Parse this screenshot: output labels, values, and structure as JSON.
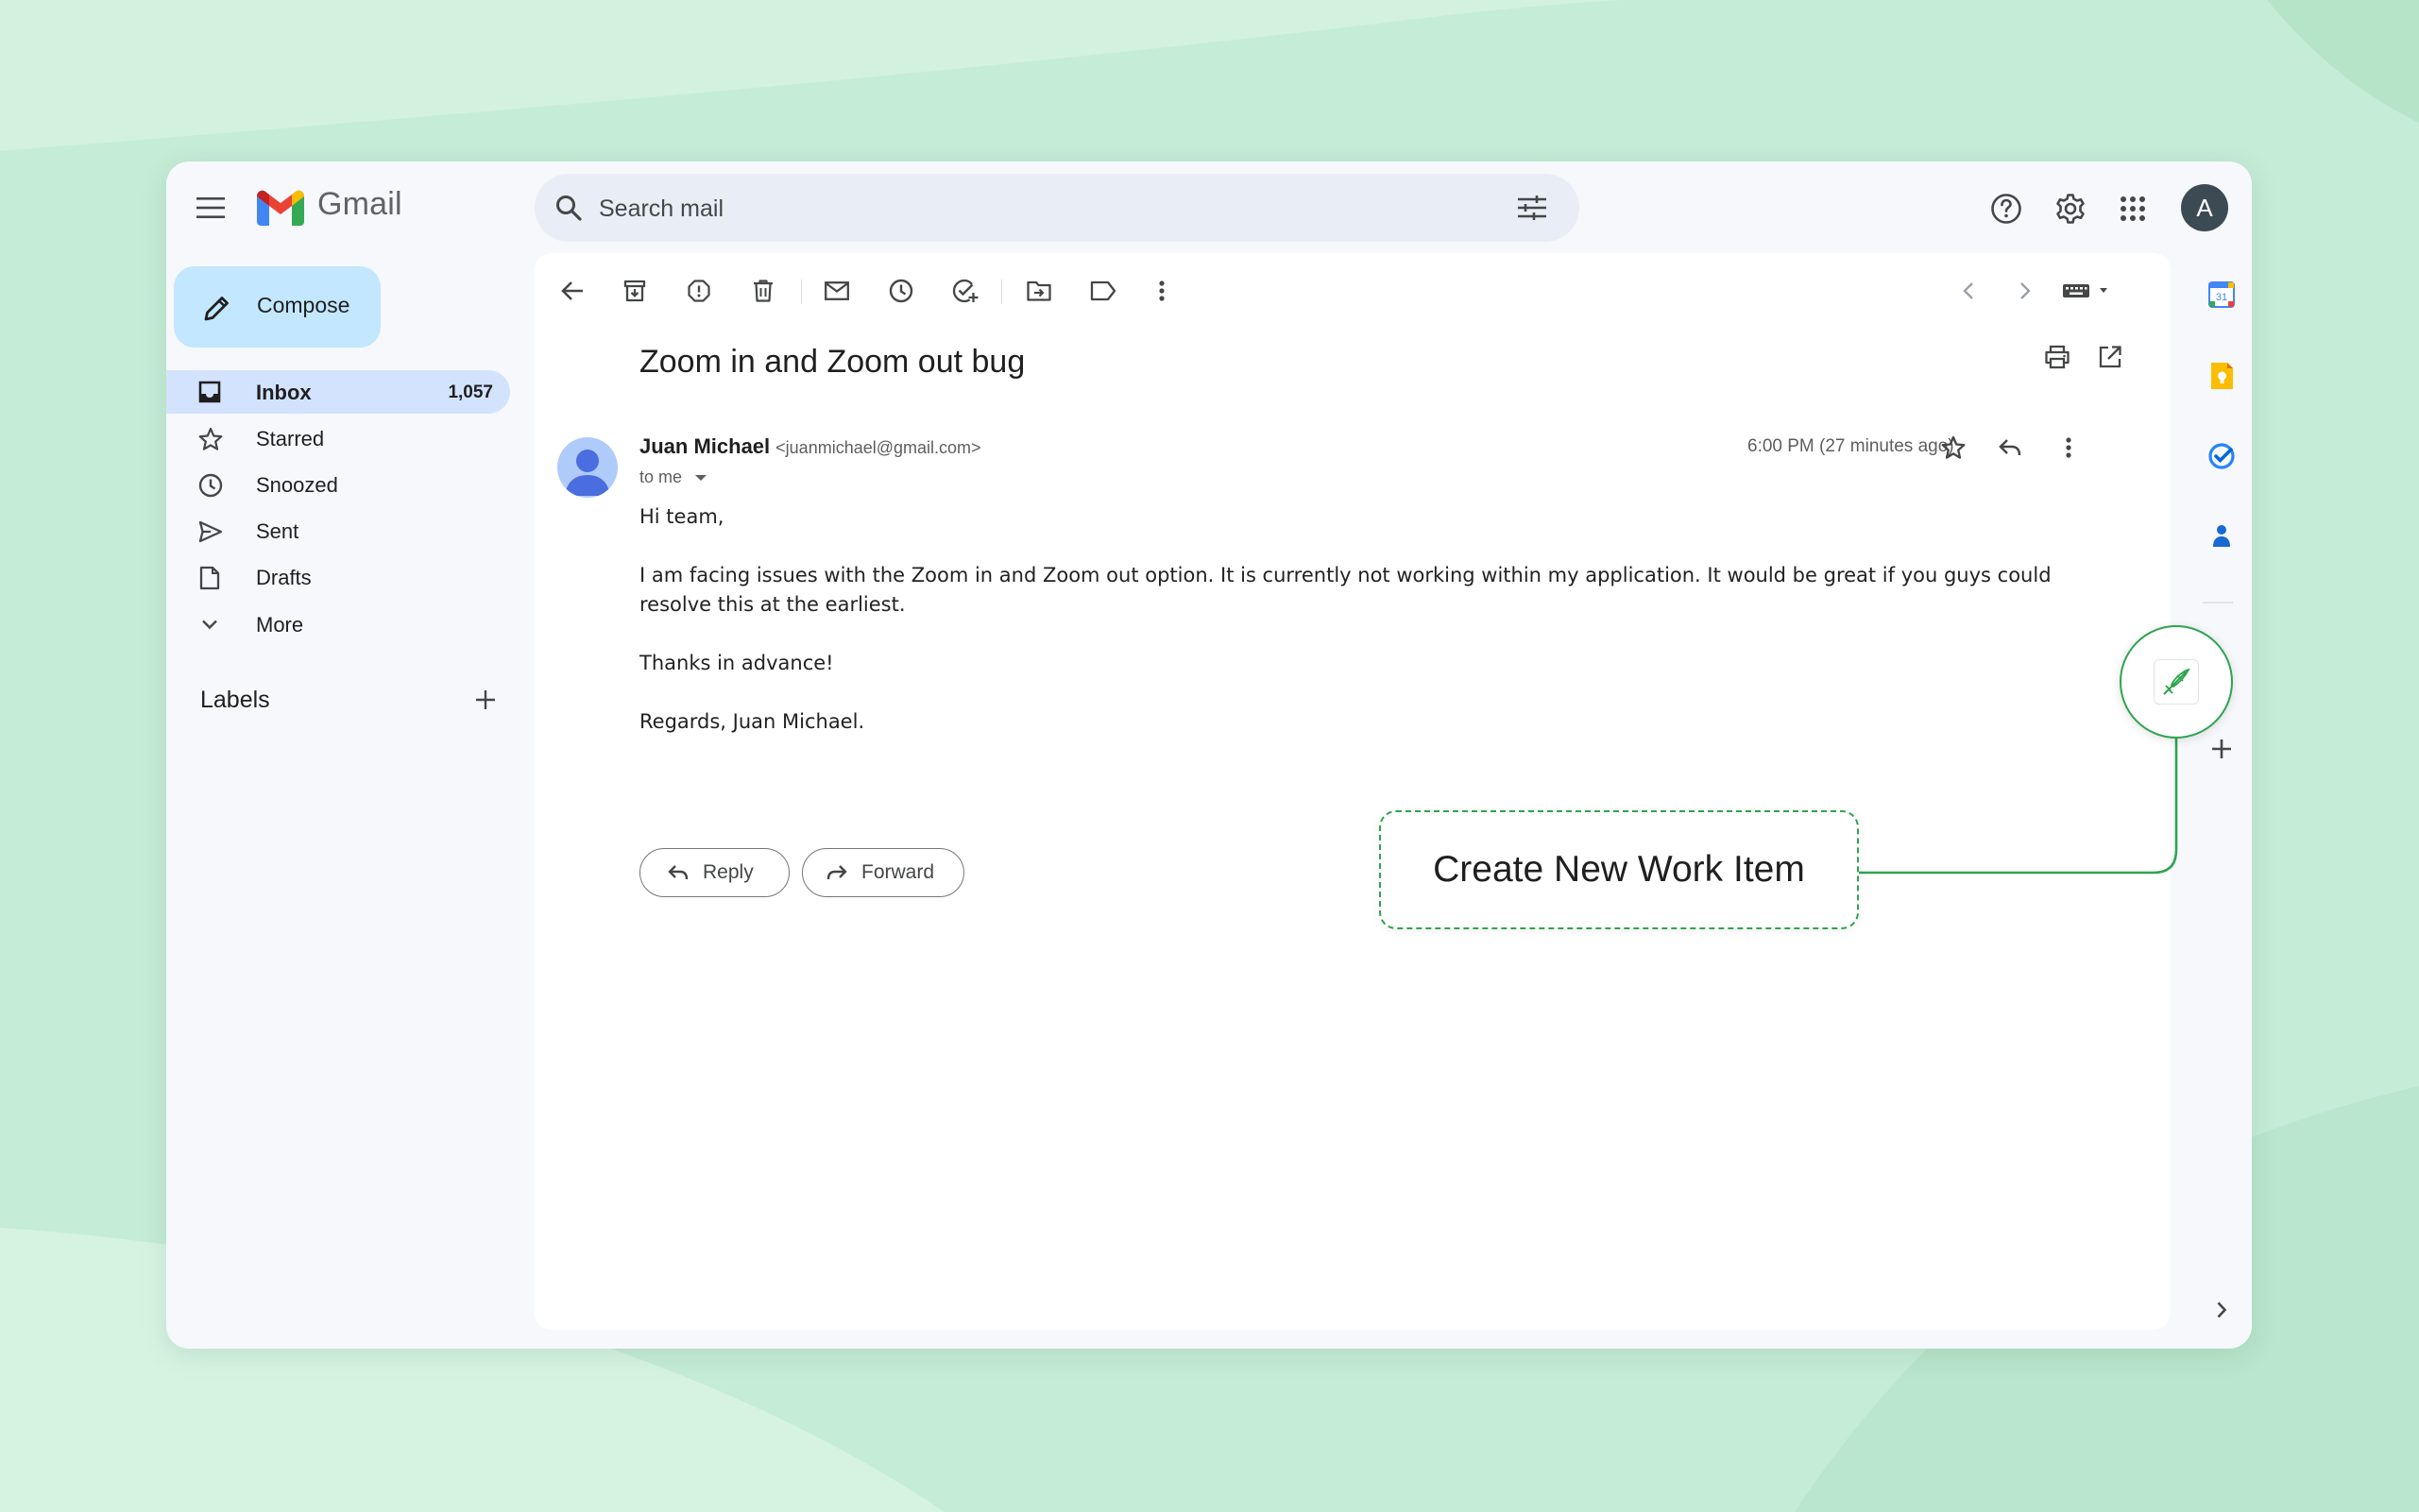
{
  "app": {
    "name": "Gmail",
    "brand_colors": {
      "red": "#ea4335",
      "blue": "#4285f4",
      "green": "#34a853",
      "yellow": "#fbbc04"
    }
  },
  "topbar": {
    "menu_icon": "hamburger-menu-icon",
    "search_placeholder": "Search mail",
    "search_icon": "search-icon",
    "filter_icon": "search-options-icon",
    "help_icon": "help-icon",
    "settings_icon": "gear-icon",
    "apps_icon": "apps-grid-icon",
    "account_initial": "A"
  },
  "sidebar": {
    "compose_label": "Compose",
    "items": [
      {
        "label": "Inbox",
        "count": "1,057",
        "icon": "inbox-icon",
        "active": true
      },
      {
        "label": "Starred",
        "count": "",
        "icon": "star-icon",
        "active": false
      },
      {
        "label": "Snoozed",
        "count": "",
        "icon": "clock-icon",
        "active": false
      },
      {
        "label": "Sent",
        "count": "",
        "icon": "send-icon",
        "active": false
      },
      {
        "label": "Drafts",
        "count": "",
        "icon": "draft-icon",
        "active": false
      },
      {
        "label": "More",
        "count": "",
        "icon": "chevron-down-icon",
        "active": false
      }
    ],
    "labels_title": "Labels"
  },
  "toolbar": {
    "icons": [
      "back-icon",
      "archive-icon",
      "report-spam-icon",
      "delete-icon",
      "mark-unread-icon",
      "snooze-icon",
      "add-task-icon",
      "move-to-icon",
      "label-icon",
      "more-vert-icon"
    ],
    "nav_icons": [
      "previous-icon",
      "next-icon",
      "keyboard-icon"
    ]
  },
  "email": {
    "subject": "Zoom in and Zoom out bug",
    "sender_name": "Juan Michael",
    "sender_email": "<juanmichael@gmail.com>",
    "to": "to me",
    "timestamp": "6:00 PM (27 minutes ago)",
    "body": [
      "Hi team,",
      "I am facing issues with the Zoom in and Zoom out option. It is currently not working within my application. It would be great if you guys could resolve this at the earliest.",
      "Thanks in advance!",
      "Regards, Juan Michael."
    ],
    "reply_label": "Reply",
    "forward_label": "Forward"
  },
  "right_rail": {
    "icons": [
      "calendar-icon",
      "keep-icon",
      "tasks-icon",
      "contacts-icon"
    ],
    "calendar_day": "31"
  },
  "overlay": {
    "callout_label": "Create New Work Item",
    "accent": "#2ea44f"
  }
}
